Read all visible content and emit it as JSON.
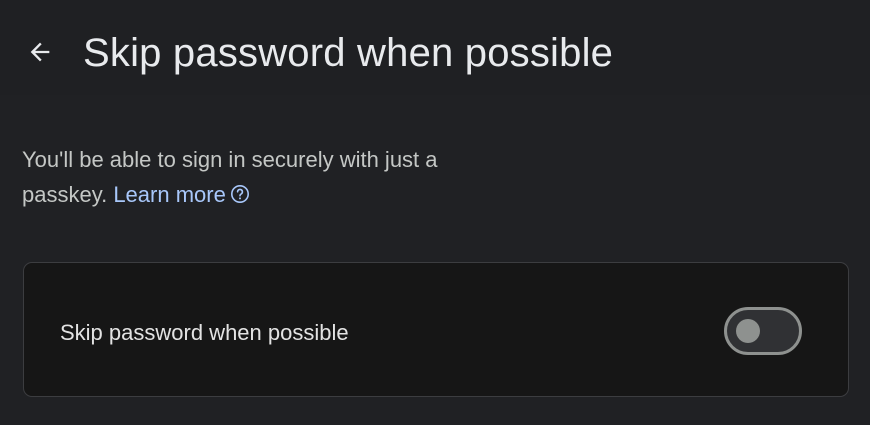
{
  "header": {
    "back_icon": "arrow-back-icon",
    "title": "Skip password when possible"
  },
  "description": {
    "text": "You'll be able to sign in securely with just a passkey. ",
    "link_label": "Learn more",
    "help_icon": "help-circle-icon"
  },
  "setting": {
    "label": "Skip password when possible",
    "toggle_state": "off"
  },
  "colors": {
    "background": "#202124",
    "card": "#161616",
    "link": "#a8c7fa",
    "toggle_outline": "#8e918f"
  }
}
